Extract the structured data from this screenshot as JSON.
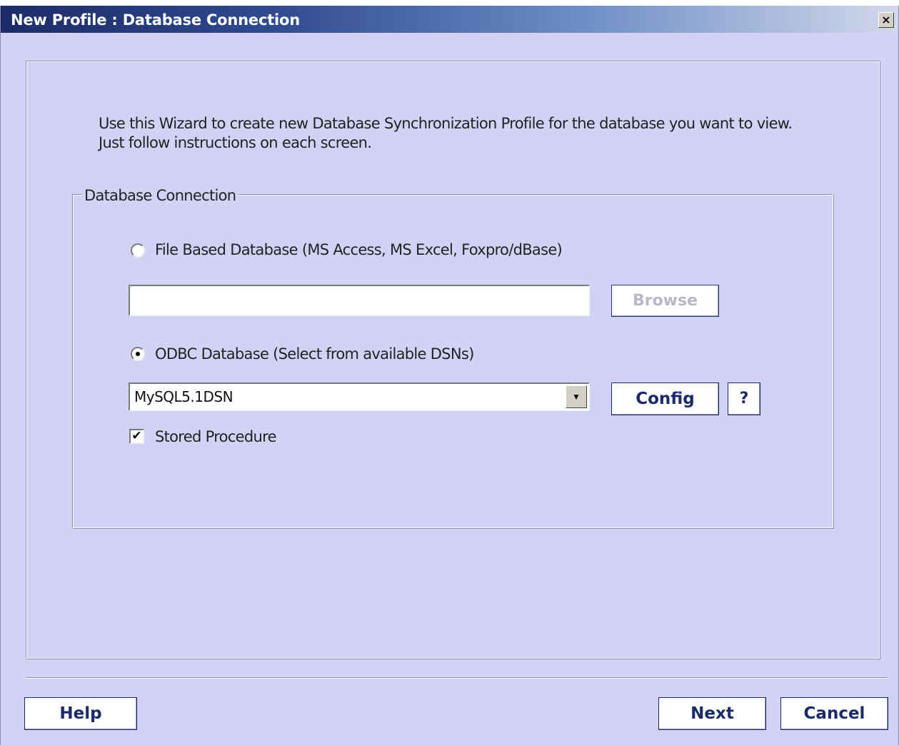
{
  "window": {
    "title": "New Profile : Database Connection",
    "close_label": "×"
  },
  "intro": {
    "text": "Use this Wizard to create new Database Synchronization Profile for the database you want to view. Just follow instructions on each screen."
  },
  "group": {
    "legend": "Database Connection"
  },
  "file_option": {
    "label": "File Based Database (MS Access, MS Excel, Foxpro/dBase)",
    "selected": false,
    "path_value": "",
    "browse_label": "Browse"
  },
  "odbc_option": {
    "label": "ODBC Database (Select from available DSNs)",
    "selected": true,
    "dsn_value": "MySQL5.1DSN",
    "config_label": "Config",
    "help_label": "?"
  },
  "stored_procedure": {
    "label": "Stored Procedure",
    "checked": true,
    "check_glyph": "✔"
  },
  "footer": {
    "help_label": "Help",
    "next_label": "Next",
    "cancel_label": "Cancel"
  },
  "icons": {
    "close": "close-icon",
    "dropdown": "chevron-down-icon",
    "check": "check-icon"
  }
}
